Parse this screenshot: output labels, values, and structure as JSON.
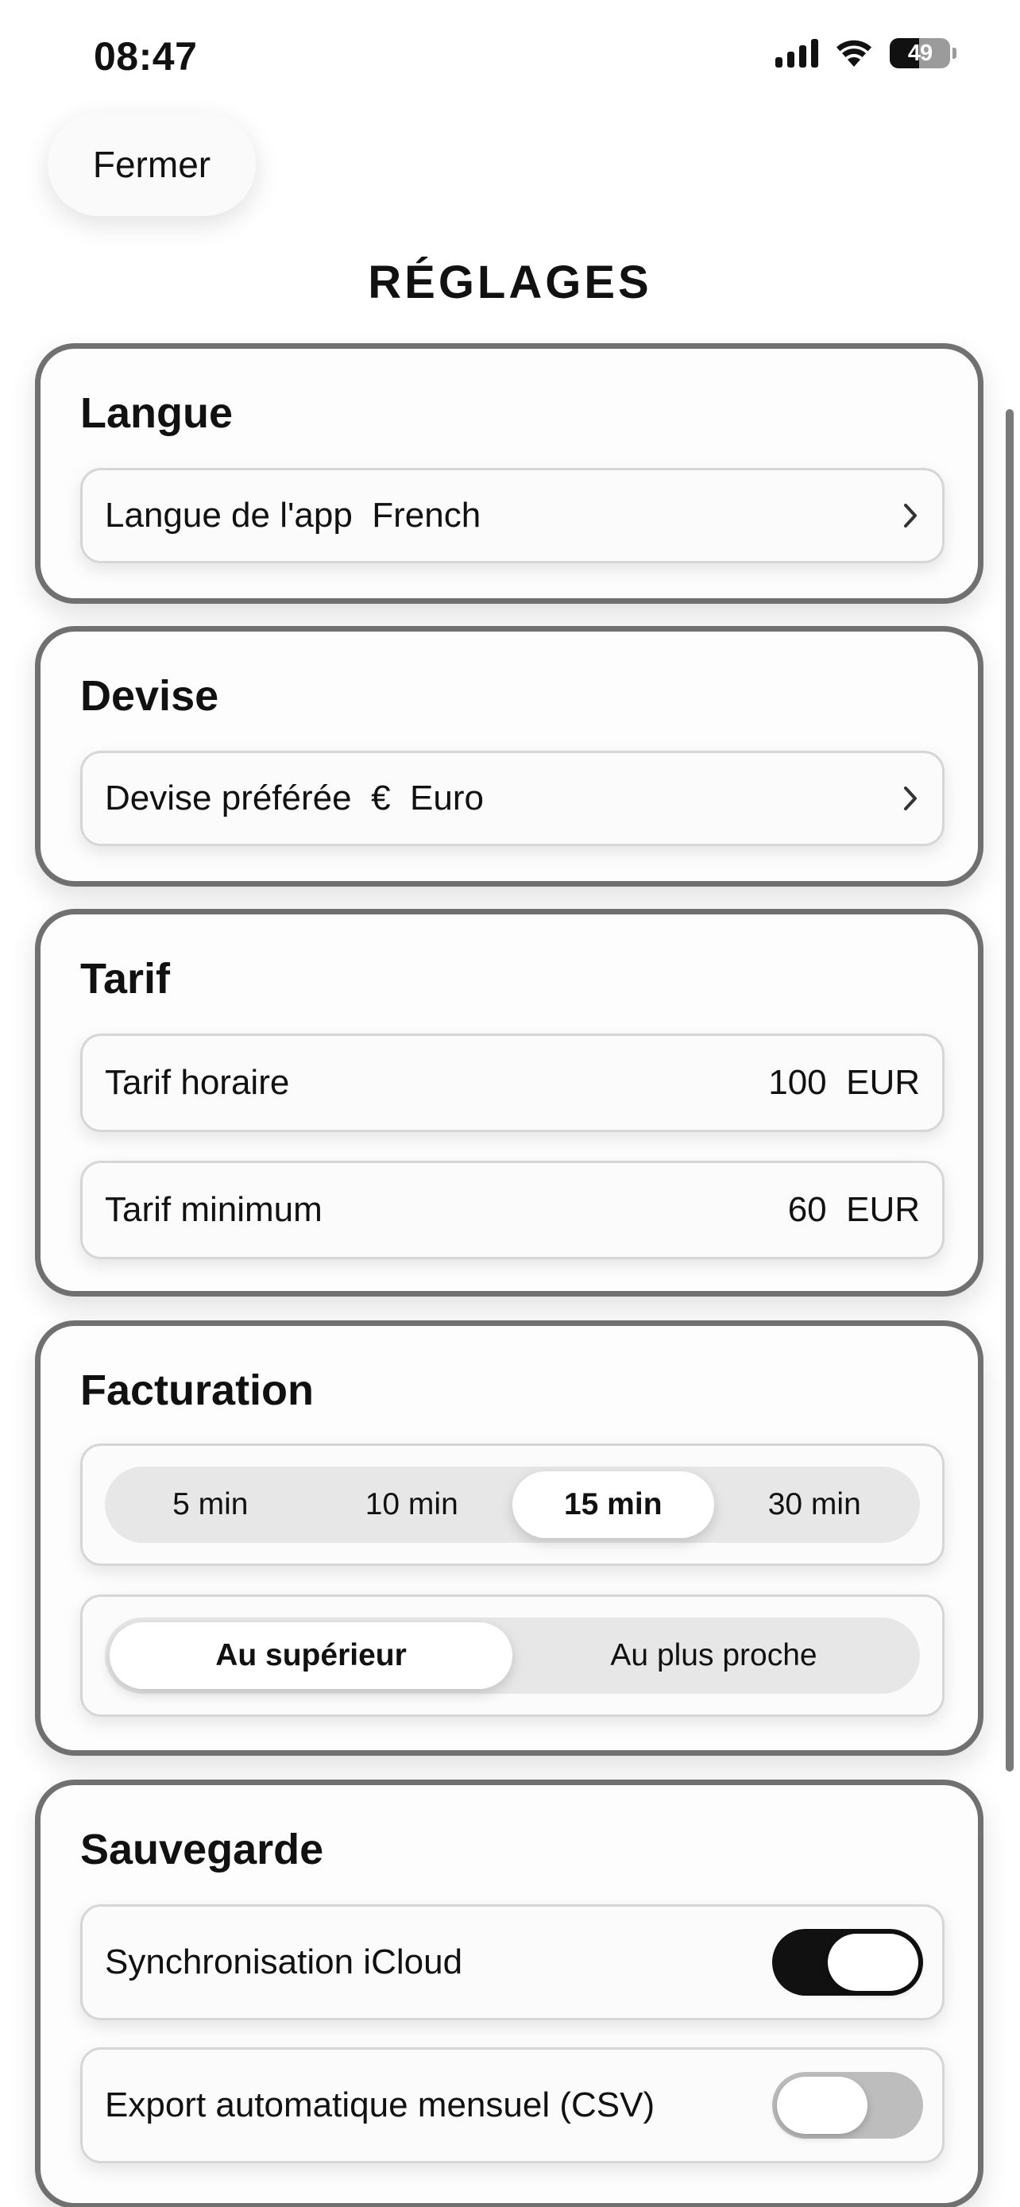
{
  "status_bar": {
    "time": "08:47",
    "battery_level": "49",
    "battery_fraction": 0.49
  },
  "header": {
    "close_label": "Fermer",
    "title": "RÉGLAGES"
  },
  "sections": {
    "language": {
      "title": "Langue",
      "row_label": "Langue de l'app",
      "row_value": "French"
    },
    "currency": {
      "title": "Devise",
      "row_label": "Devise préférée",
      "symbol": "€",
      "row_value": "Euro"
    },
    "rate": {
      "title": "Tarif",
      "hourly_label": "Tarif horaire",
      "hourly_value": "100",
      "hourly_unit": "EUR",
      "minimum_label": "Tarif minimum",
      "minimum_value": "60",
      "minimum_unit": "EUR"
    },
    "billing": {
      "title": "Facturation",
      "increments": [
        "5 min",
        "10 min",
        "15 min",
        "30 min"
      ],
      "selected_increment": "15 min",
      "rounding": [
        "Au supérieur",
        "Au plus proche"
      ],
      "selected_rounding": "Au supérieur"
    },
    "backup": {
      "title": "Sauvegarde",
      "icloud_label": "Synchronisation iCloud",
      "icloud_on": true,
      "export_label": "Export automatique mensuel (CSV)",
      "export_on": false
    }
  },
  "colors": {
    "card_border": "#707070",
    "toggle_on": "#111111",
    "toggle_off": "#bdbdbd",
    "segment_track": "#e7e7e7"
  }
}
